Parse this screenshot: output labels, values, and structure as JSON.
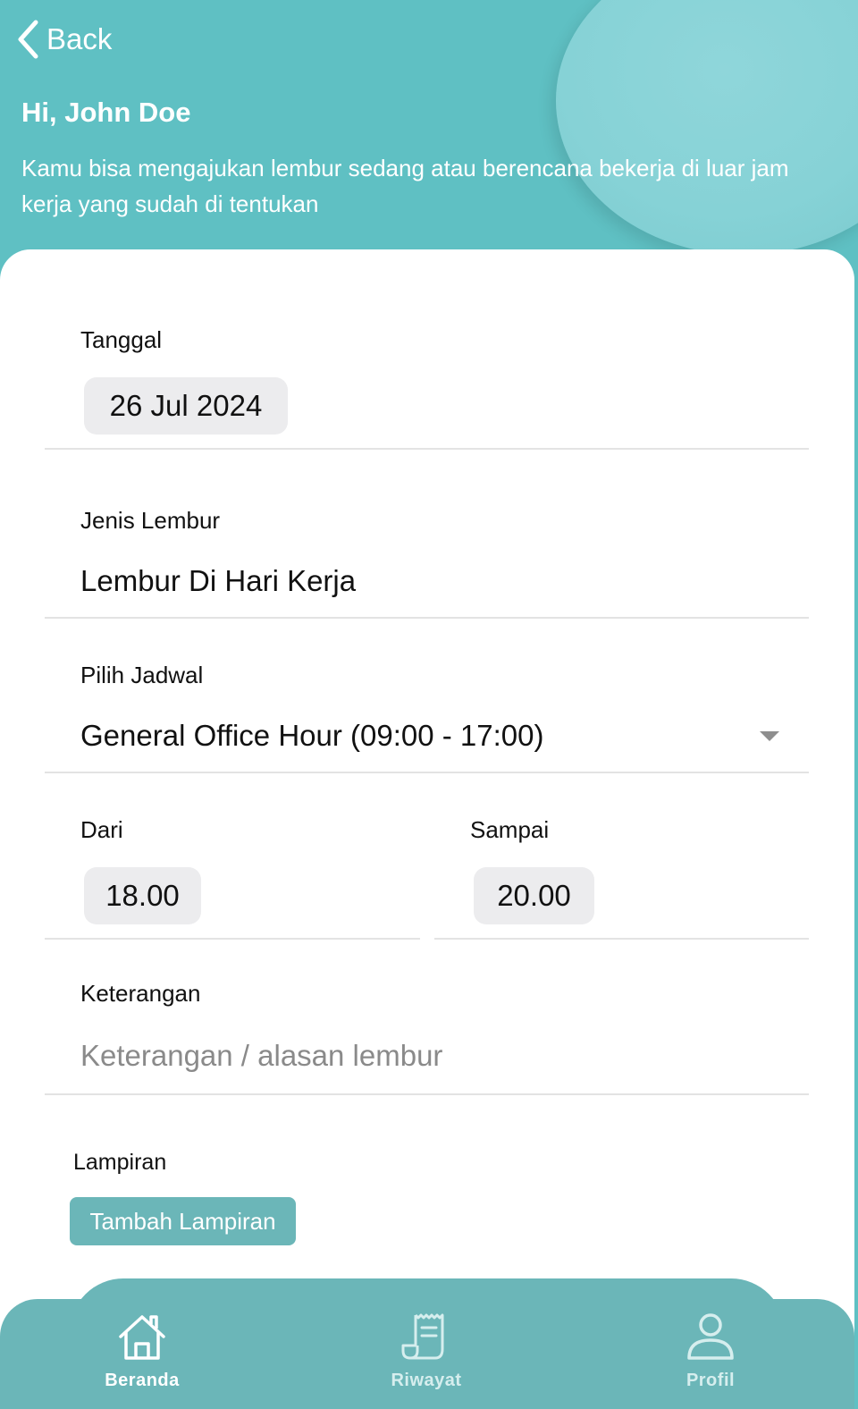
{
  "header": {
    "back_label": "Back",
    "greeting": "Hi, John Doe",
    "intro": "Kamu bisa mengajukan lembur sedang atau berencana bekerja di luar jam kerja yang sudah di tentukan"
  },
  "form": {
    "tanggal": {
      "label": "Tanggal",
      "value": "26 Jul 2024"
    },
    "jenis_lembur": {
      "label": "Jenis Lembur",
      "value": "Lembur Di Hari Kerja"
    },
    "jadwal": {
      "label": "Pilih Jadwal",
      "value": "General Office Hour (09:00 - 17:00)"
    },
    "dari": {
      "label": "Dari",
      "value": "18.00"
    },
    "sampai": {
      "label": "Sampai",
      "value": "20.00"
    },
    "keterangan": {
      "label": "Keterangan",
      "placeholder": "Keterangan / alasan lembur"
    },
    "lampiran": {
      "label": "Lampiran",
      "button": "Tambah Lampiran"
    }
  },
  "nav": {
    "items": [
      {
        "label": "Beranda",
        "icon": "home-icon",
        "active": true
      },
      {
        "label": "Riwayat",
        "icon": "receipt-icon",
        "active": false
      },
      {
        "label": "Profil",
        "icon": "person-icon",
        "active": false
      }
    ]
  },
  "colors": {
    "header_bg": "#5fc0c3",
    "nav_bg": "#6bb6b8",
    "chip_bg": "#ececee",
    "nav_active": "#ffffff",
    "nav_inactive": "#d6eeee"
  }
}
